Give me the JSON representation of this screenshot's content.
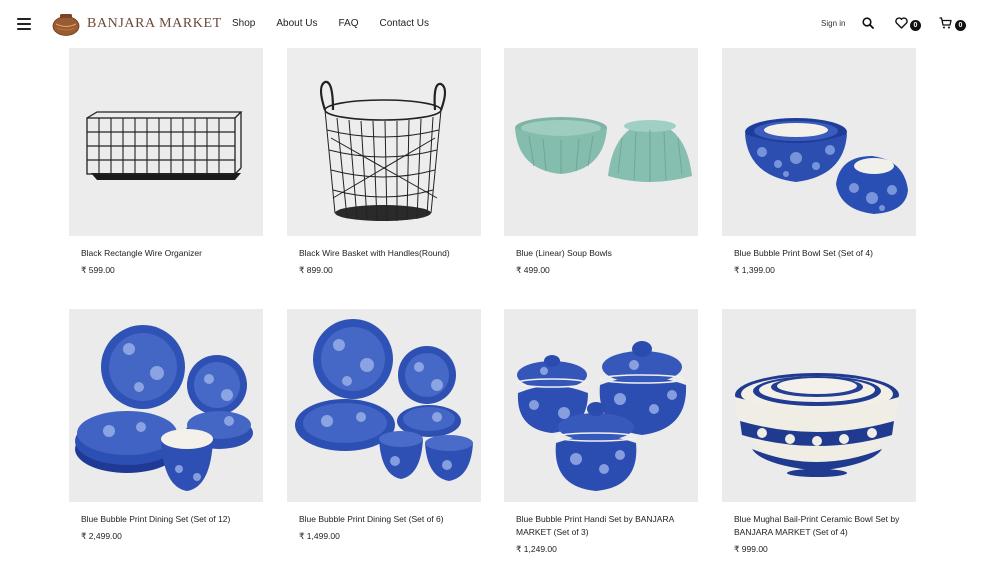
{
  "header": {
    "logo_text": "BANJARA MARKET",
    "nav": [
      "Shop",
      "About Us",
      "FAQ",
      "Contact Us"
    ],
    "signin_label": "Sign in",
    "wishlist_count": "0",
    "cart_count": "0"
  },
  "products": [
    {
      "name": "Black Rectangle Wire Organizer",
      "price": "₹ 599.00",
      "image": "black-rectangle-wire-organizer"
    },
    {
      "name": "Black Wire Basket with Handles(Round)",
      "price": "₹ 899.00",
      "image": "black-wire-basket-round"
    },
    {
      "name": "Blue (Linear) Soup Bowls",
      "price": "₹ 499.00",
      "image": "blue-linear-soup-bowls"
    },
    {
      "name": "Blue Bubble Print Bowl Set (Set of 4)",
      "price": "₹ 1,399.00",
      "image": "blue-bubble-bowl-set"
    },
    {
      "name": "Blue Bubble Print Dining Set (Set of 12)",
      "price": "₹ 2,499.00",
      "image": "blue-bubble-dining-12"
    },
    {
      "name": "Blue Bubble Print Dining Set (Set of 6)",
      "price": "₹ 1,499.00",
      "image": "blue-bubble-dining-6"
    },
    {
      "name": "Blue Bubble Print Handi Set by BANJARA MARKET (Set of 3)",
      "price": "₹ 1,249.00",
      "image": "blue-bubble-handi-set"
    },
    {
      "name": "Blue Mughal Bail-Print Ceramic Bowl Set by BANJARA MARKET (Set of 4)",
      "price": "₹ 999.00",
      "image": "blue-mughal-bowl-set"
    }
  ]
}
